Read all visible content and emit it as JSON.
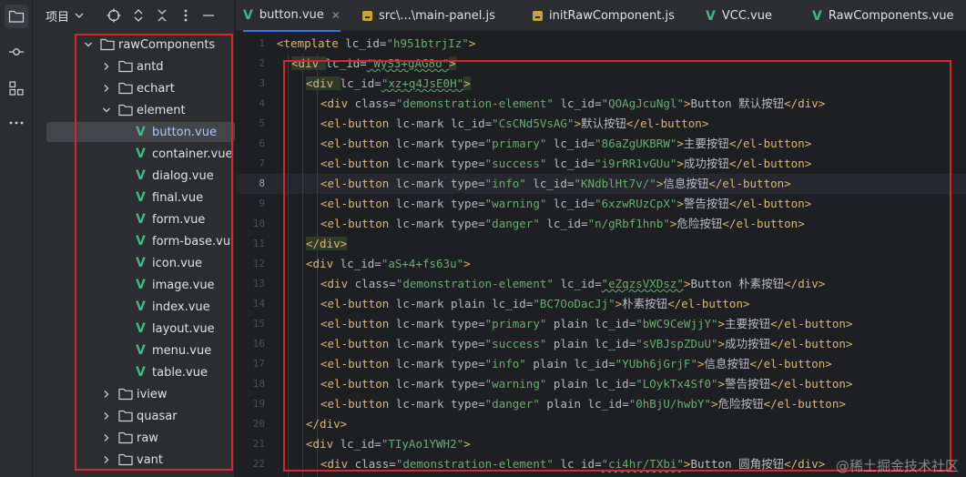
{
  "project_panel": {
    "title": "项目",
    "tree": [
      {
        "label": "rawComponents",
        "type": "folder",
        "expanded": true,
        "depth": 0
      },
      {
        "label": "antd",
        "type": "folder",
        "expanded": false,
        "depth": 1
      },
      {
        "label": "echart",
        "type": "folder",
        "expanded": false,
        "depth": 1
      },
      {
        "label": "element",
        "type": "folder",
        "expanded": true,
        "depth": 1
      },
      {
        "label": "button.vue",
        "type": "vue",
        "depth": 2,
        "selected": true
      },
      {
        "label": "container.vue",
        "type": "vue",
        "depth": 2
      },
      {
        "label": "dialog.vue",
        "type": "vue",
        "depth": 2
      },
      {
        "label": "final.vue",
        "type": "vue",
        "depth": 2
      },
      {
        "label": "form.vue",
        "type": "vue",
        "depth": 2
      },
      {
        "label": "form-base.vu",
        "type": "vue",
        "depth": 2
      },
      {
        "label": "icon.vue",
        "type": "vue",
        "depth": 2
      },
      {
        "label": "image.vue",
        "type": "vue",
        "depth": 2
      },
      {
        "label": "index.vue",
        "type": "vue",
        "depth": 2
      },
      {
        "label": "layout.vue",
        "type": "vue",
        "depth": 2
      },
      {
        "label": "menu.vue",
        "type": "vue",
        "depth": 2
      },
      {
        "label": "table.vue",
        "type": "vue",
        "depth": 2
      },
      {
        "label": "iview",
        "type": "folder",
        "expanded": false,
        "depth": 1
      },
      {
        "label": "quasar",
        "type": "folder",
        "expanded": false,
        "depth": 1
      },
      {
        "label": "raw",
        "type": "folder",
        "expanded": false,
        "depth": 1
      },
      {
        "label": "vant",
        "type": "folder",
        "expanded": false,
        "depth": 1
      }
    ]
  },
  "tabs": [
    {
      "label": "button.vue",
      "kind": "vue",
      "active": true,
      "closable": true
    },
    {
      "label": "src\\...\\main-panel.js",
      "kind": "js"
    },
    {
      "label": "initRawComponent.js",
      "kind": "js"
    },
    {
      "label": "VCC.vue",
      "kind": "vue"
    },
    {
      "label": "RawComponents.vue",
      "kind": "vue"
    }
  ],
  "editor": {
    "current_line": 8,
    "lines": [
      {
        "n": "1",
        "indent": 0,
        "tokens": [
          [
            "t",
            "<template "
          ],
          [
            "a",
            "lc_id"
          ],
          [
            "p",
            "="
          ],
          [
            "s",
            "\"h951btrjIz\""
          ],
          [
            "t",
            ">"
          ]
        ]
      },
      {
        "n": "2",
        "indent": 1,
        "tokens": [
          [
            "t",
            "<div "
          ],
          [
            "a",
            "lc_id"
          ],
          [
            "p",
            "="
          ],
          [
            "s",
            "\"WyS3+gAG8o\""
          ],
          [
            "t",
            ">"
          ]
        ]
      },
      {
        "n": "3",
        "indent": 2,
        "tokens": [
          [
            "t",
            "<div "
          ],
          [
            "a",
            "lc_id"
          ],
          [
            "p",
            "="
          ],
          [
            "s",
            "\"xz+q4JsE0H\""
          ],
          [
            "t",
            ">"
          ]
        ]
      },
      {
        "n": "4",
        "indent": 3,
        "tokens": [
          [
            "t",
            "<div "
          ],
          [
            "a",
            "class"
          ],
          [
            "p",
            "="
          ],
          [
            "s",
            "\"demonstration-element\""
          ],
          [
            "p",
            " "
          ],
          [
            "a",
            "lc_id"
          ],
          [
            "p",
            "="
          ],
          [
            "s",
            "\"QOAgJcuNgl\""
          ],
          [
            "t",
            ">"
          ],
          [
            "tx",
            "Button 默认按钮"
          ],
          [
            "t",
            "</div>"
          ]
        ]
      },
      {
        "n": "5",
        "indent": 3,
        "tokens": [
          [
            "t",
            "<el-button "
          ],
          [
            "a",
            "lc-mark lc_id"
          ],
          [
            "p",
            "="
          ],
          [
            "s",
            "\"CsCNd5VsAG\""
          ],
          [
            "t",
            ">"
          ],
          [
            "tx",
            "默认按钮"
          ],
          [
            "t",
            "</el-button>"
          ]
        ]
      },
      {
        "n": "6",
        "indent": 3,
        "tokens": [
          [
            "t",
            "<el-button "
          ],
          [
            "a",
            "lc-mark type"
          ],
          [
            "p",
            "="
          ],
          [
            "s",
            "\"primary\""
          ],
          [
            "p",
            " "
          ],
          [
            "a",
            "lc_id"
          ],
          [
            "p",
            "="
          ],
          [
            "s",
            "\"86aZgUKBRW\""
          ],
          [
            "t",
            ">"
          ],
          [
            "tx",
            "主要按钮"
          ],
          [
            "t",
            "</el-button>"
          ]
        ]
      },
      {
        "n": "7",
        "indent": 3,
        "tokens": [
          [
            "t",
            "<el-button "
          ],
          [
            "a",
            "lc-mark type"
          ],
          [
            "p",
            "="
          ],
          [
            "s",
            "\"success\""
          ],
          [
            "p",
            " "
          ],
          [
            "a",
            "lc_id"
          ],
          [
            "p",
            "="
          ],
          [
            "s",
            "\"i9rRR1vGUu\""
          ],
          [
            "t",
            ">"
          ],
          [
            "tx",
            "成功按钮"
          ],
          [
            "t",
            "</el-button>"
          ]
        ]
      },
      {
        "n": "8",
        "indent": 3,
        "tokens": [
          [
            "t",
            "<el-button "
          ],
          [
            "a",
            "lc-mark type"
          ],
          [
            "p",
            "="
          ],
          [
            "s",
            "\"info\""
          ],
          [
            "p",
            " "
          ],
          [
            "a",
            "lc_id"
          ],
          [
            "p",
            "="
          ],
          [
            "s",
            "\"KNdblHt7v/\""
          ],
          [
            "t",
            ">"
          ],
          [
            "tx",
            "信息按钮"
          ],
          [
            "t",
            "</el-button>"
          ]
        ]
      },
      {
        "n": "9",
        "indent": 3,
        "tokens": [
          [
            "t",
            "<el-button "
          ],
          [
            "a",
            "lc-mark type"
          ],
          [
            "p",
            "="
          ],
          [
            "s",
            "\"warning\""
          ],
          [
            "p",
            " "
          ],
          [
            "a",
            "lc_id"
          ],
          [
            "p",
            "="
          ],
          [
            "s",
            "\"6xzwRUzCpX\""
          ],
          [
            "t",
            ">"
          ],
          [
            "tx",
            "警告按钮"
          ],
          [
            "t",
            "</el-button>"
          ]
        ]
      },
      {
        "n": "10",
        "indent": 3,
        "tokens": [
          [
            "t",
            "<el-button "
          ],
          [
            "a",
            "lc-mark type"
          ],
          [
            "p",
            "="
          ],
          [
            "s",
            "\"danger\""
          ],
          [
            "p",
            " "
          ],
          [
            "a",
            "lc_id"
          ],
          [
            "p",
            "="
          ],
          [
            "s",
            "\"n/gRbf1hnb\""
          ],
          [
            "t",
            ">"
          ],
          [
            "tx",
            "危险按钮"
          ],
          [
            "t",
            "</el-button>"
          ]
        ]
      },
      {
        "n": "11",
        "indent": 2,
        "tokens": [
          [
            "t",
            "</div>"
          ]
        ]
      },
      {
        "n": "12",
        "indent": 2,
        "tokens": [
          [
            "t",
            "<div "
          ],
          [
            "a",
            "lc_id"
          ],
          [
            "p",
            "="
          ],
          [
            "s",
            "\"aS+4+fs63u\""
          ],
          [
            "t",
            ">"
          ]
        ]
      },
      {
        "n": "13",
        "indent": 3,
        "tokens": [
          [
            "t",
            "<div "
          ],
          [
            "a",
            "class"
          ],
          [
            "p",
            "="
          ],
          [
            "s",
            "\"demonstration-element\""
          ],
          [
            "p",
            " "
          ],
          [
            "a",
            "lc_id"
          ],
          [
            "p",
            "="
          ],
          [
            "s",
            "\"eZqzsVXDsz\""
          ],
          [
            "t",
            ">"
          ],
          [
            "tx",
            "Button 朴素按钮"
          ],
          [
            "t",
            "</div>"
          ]
        ]
      },
      {
        "n": "14",
        "indent": 3,
        "tokens": [
          [
            "t",
            "<el-button "
          ],
          [
            "a",
            "lc-mark plain lc_id"
          ],
          [
            "p",
            "="
          ],
          [
            "s",
            "\"BC7OoDacJj\""
          ],
          [
            "t",
            ">"
          ],
          [
            "tx",
            "朴素按钮"
          ],
          [
            "t",
            "</el-button>"
          ]
        ]
      },
      {
        "n": "15",
        "indent": 3,
        "tokens": [
          [
            "t",
            "<el-button "
          ],
          [
            "a",
            "lc-mark type"
          ],
          [
            "p",
            "="
          ],
          [
            "s",
            "\"primary\""
          ],
          [
            "p",
            " "
          ],
          [
            "a",
            "plain lc_id"
          ],
          [
            "p",
            "="
          ],
          [
            "s",
            "\"bWC9CeWjjY\""
          ],
          [
            "t",
            ">"
          ],
          [
            "tx",
            "主要按钮"
          ],
          [
            "t",
            "</el-button>"
          ]
        ]
      },
      {
        "n": "16",
        "indent": 3,
        "tokens": [
          [
            "t",
            "<el-button "
          ],
          [
            "a",
            "lc-mark type"
          ],
          [
            "p",
            "="
          ],
          [
            "s",
            "\"success\""
          ],
          [
            "p",
            " "
          ],
          [
            "a",
            "plain lc_id"
          ],
          [
            "p",
            "="
          ],
          [
            "s",
            "\"sVBJspZDuU\""
          ],
          [
            "t",
            ">"
          ],
          [
            "tx",
            "成功按钮"
          ],
          [
            "t",
            "</el-button>"
          ]
        ]
      },
      {
        "n": "17",
        "indent": 3,
        "tokens": [
          [
            "t",
            "<el-button "
          ],
          [
            "a",
            "lc-mark type"
          ],
          [
            "p",
            "="
          ],
          [
            "s",
            "\"info\""
          ],
          [
            "p",
            " "
          ],
          [
            "a",
            "plain lc_id"
          ],
          [
            "p",
            "="
          ],
          [
            "s",
            "\"YUbh6jGrjF\""
          ],
          [
            "t",
            ">"
          ],
          [
            "tx",
            "信息按钮"
          ],
          [
            "t",
            "</el-button>"
          ]
        ]
      },
      {
        "n": "18",
        "indent": 3,
        "tokens": [
          [
            "t",
            "<el-button "
          ],
          [
            "a",
            "lc-mark type"
          ],
          [
            "p",
            "="
          ],
          [
            "s",
            "\"warning\""
          ],
          [
            "p",
            " "
          ],
          [
            "a",
            "plain lc_id"
          ],
          [
            "p",
            "="
          ],
          [
            "s",
            "\"LOykTx4Sf0\""
          ],
          [
            "t",
            ">"
          ],
          [
            "tx",
            "警告按钮"
          ],
          [
            "t",
            "</el-button>"
          ]
        ]
      },
      {
        "n": "19",
        "indent": 3,
        "tokens": [
          [
            "t",
            "<el-button "
          ],
          [
            "a",
            "lc-mark type"
          ],
          [
            "p",
            "="
          ],
          [
            "s",
            "\"danger\""
          ],
          [
            "p",
            " "
          ],
          [
            "a",
            "plain lc_id"
          ],
          [
            "p",
            "="
          ],
          [
            "s",
            "\"0hBjU/hwbY\""
          ],
          [
            "t",
            ">"
          ],
          [
            "tx",
            "危险按钮"
          ],
          [
            "t",
            "</el-button>"
          ]
        ]
      },
      {
        "n": "20",
        "indent": 2,
        "tokens": [
          [
            "t",
            "</div>"
          ]
        ]
      },
      {
        "n": "21",
        "indent": 2,
        "tokens": [
          [
            "t",
            "<div "
          ],
          [
            "a",
            "lc_id"
          ],
          [
            "p",
            "="
          ],
          [
            "s",
            "\"TIyAo1YWH2\""
          ],
          [
            "t",
            ">"
          ]
        ]
      },
      {
        "n": "22",
        "indent": 3,
        "tokens": [
          [
            "t",
            "<div "
          ],
          [
            "a",
            "class"
          ],
          [
            "p",
            "="
          ],
          [
            "s",
            "\"demonstration-element\""
          ],
          [
            "p",
            " "
          ],
          [
            "a",
            "lc_id"
          ],
          [
            "p",
            "="
          ],
          [
            "s",
            "\"ci4hr/TXbi\""
          ],
          [
            "t",
            ">"
          ],
          [
            "tx",
            "Button 圆角按钮"
          ],
          [
            "t",
            "</div>"
          ]
        ]
      }
    ]
  },
  "watermark": "@稀土掘金技术社区",
  "colors": {
    "bg": "#1e1f22",
    "panel": "#2b2d30",
    "tag": "#d5b778",
    "string": "#6aab73",
    "vue": "#41b883",
    "accent": "#3574f0",
    "highlight_box": "#d9262e"
  }
}
